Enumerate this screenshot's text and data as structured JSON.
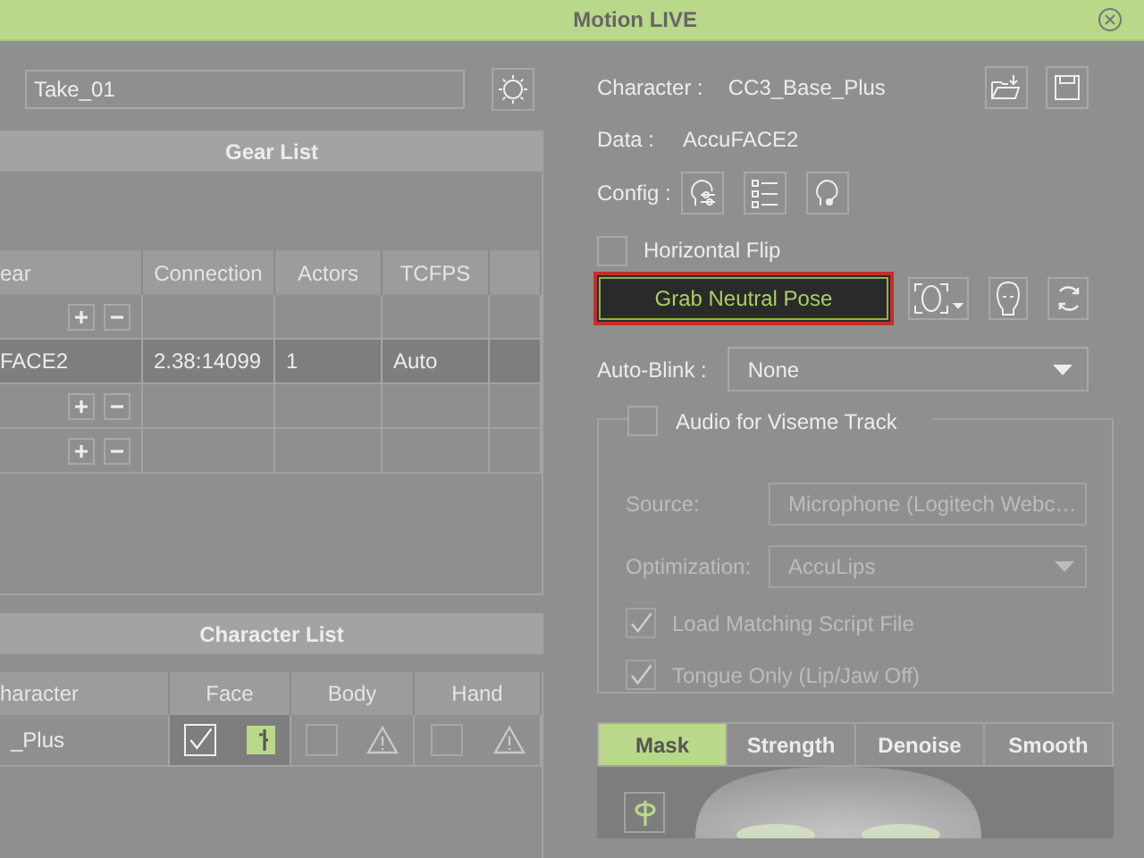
{
  "window": {
    "title": "Motion LIVE"
  },
  "take": {
    "value": "Take_01"
  },
  "gear_list": {
    "title": "Gear List",
    "columns": [
      "ear",
      "Connection",
      "Actors",
      "TCFPS"
    ],
    "rows": [
      {
        "kind": "add_remove",
        "selected": false
      },
      {
        "kind": "device",
        "gear": "FACE2",
        "connection": "2.38:14099",
        "actors": "1",
        "tcfps": "Auto",
        "selected": true
      },
      {
        "kind": "add_remove",
        "selected": false
      },
      {
        "kind": "add_remove",
        "selected": false
      }
    ]
  },
  "character_list": {
    "title": "Character List",
    "columns": [
      "haracter",
      "Face",
      "Body",
      "Hand"
    ],
    "rows": [
      {
        "character": "_Plus",
        "parts": [
          {
            "checked": true,
            "kind": "ok"
          },
          {
            "checked": false,
            "kind": "warning"
          },
          {
            "checked": false,
            "kind": "warning"
          }
        ]
      }
    ]
  },
  "character": {
    "label": "Character :",
    "value": "CC3_Base_Plus"
  },
  "data": {
    "label": "Data :",
    "value": "AccuFACE2"
  },
  "config": {
    "label": "Config :"
  },
  "horizontal_flip": {
    "label": "Horizontal Flip",
    "checked": false
  },
  "grab_button": {
    "label": "Grab Neutral Pose"
  },
  "auto_blink": {
    "label": "Auto-Blink :",
    "value": "None"
  },
  "audio_viseme": {
    "label": "Audio for Viseme Track",
    "checked": false,
    "fields": [
      {
        "label": "Source:",
        "value": "Microphone (Logitech Webc…",
        "disabled": true
      },
      {
        "label": "Optimization:",
        "value": "AccuLips",
        "disabled": true
      }
    ],
    "options": [
      {
        "label": "Load Matching Script File",
        "checked": true,
        "disabled": true
      },
      {
        "label": "Tongue Only (Lip/Jaw Off)",
        "checked": true,
        "disabled": true
      }
    ]
  },
  "tabs": [
    {
      "label": "Mask",
      "selected": true
    },
    {
      "label": "Strength",
      "selected": false
    },
    {
      "label": "Denoise",
      "selected": false
    },
    {
      "label": "Smooth",
      "selected": false
    }
  ]
}
